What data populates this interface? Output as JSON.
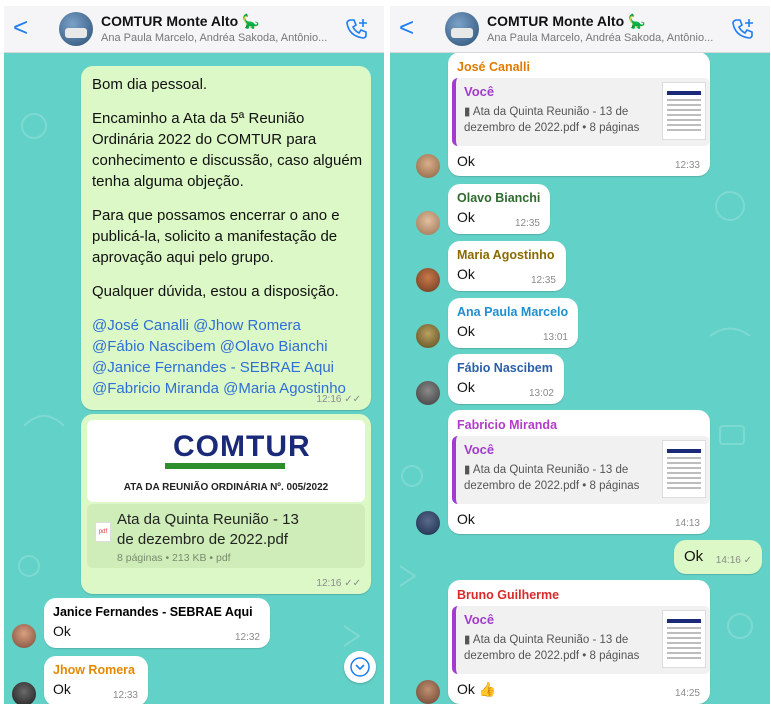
{
  "header": {
    "back_glyph": "<",
    "group_name": "COMTUR Monte Alto",
    "group_emoji": "🦕",
    "members": "Ana Paula Marcelo, Andréa Sakoda, Antônio..."
  },
  "left": {
    "announcement": {
      "p1": "Bom dia pessoal.",
      "p2": "Encaminho a Ata da 5ª Reunião Ordinária 2022 do COMTUR para conhecimento e discussão, caso alguém tenha alguma objeção.",
      "p3": "Para que possamos encerrar o ano e publicá-la, solicito a manifestação de aprovação aqui pelo grupo.",
      "p4": "Qualquer dúvida, estou a disposição.",
      "mentions": [
        "@José Canalli",
        "@Jhow Romera",
        "@Fábio Nascibem",
        "@Olavo Bianchi",
        "@Janice Fernandes - SEBRAE Aqui",
        "@Fabricio Miranda",
        "@Maria Agostinho"
      ],
      "time": "12:16",
      "ticks": "✓✓"
    },
    "document": {
      "logo_text": "COMTUR",
      "preview_heading": "ATA DA REUNIÃO ORDINÁRIA Nº. 005/2022",
      "pdf_icon_label": "pdf",
      "file_name": "Ata da Quinta Reunião - 13 de dezembro de 2022.pdf",
      "meta": "8 páginas • 213 KB • pdf",
      "time": "12:16",
      "ticks": "✓✓"
    },
    "replies": [
      {
        "sender": "Janice Fernandes - SEBRAE Aqui",
        "color": "#1e6b1e",
        "text": "Ok",
        "time": "12:32"
      },
      {
        "sender": "Jhow Romera",
        "color": "#e38a00",
        "text": "Ok",
        "time": "12:33"
      }
    ]
  },
  "right": {
    "quote": {
      "name": "Você",
      "doc_icon": "▮",
      "file": "Ata da Quinta Reunião - 13 de dezembro de 2022.pdf • 8 páginas"
    },
    "messages": [
      {
        "sender": "José Canalli",
        "color": "#e07b00",
        "text": "Ok",
        "time": "12:33"
      },
      {
        "sender": "Olavo Bianchi",
        "color": "#2e6b2e",
        "text": "Ok",
        "time": "12:35"
      },
      {
        "sender": "Maria Agostinho",
        "color": "#8a6a00",
        "text": "Ok",
        "time": "12:35"
      },
      {
        "sender": "Ana Paula Marcelo",
        "color": "#1f8fcf",
        "text": "Ok",
        "time": "13:01"
      },
      {
        "sender": "Fábio Nascibem",
        "color": "#2b5ea8",
        "text": "Ok",
        "time": "13:02"
      },
      {
        "sender": "Fabricio Miranda",
        "color": "#b23bc9",
        "text": "Ok",
        "time": "14:13"
      },
      {
        "sender": "Bruno Guilherme",
        "color": "#d82a2a",
        "text": "Ok 👍",
        "time": "14:25"
      }
    ],
    "own_reply": {
      "text": "Ok",
      "time": "14:16",
      "tick": "✓"
    }
  },
  "colors": {
    "chat_bg": "#62d1c7",
    "outgoing": "#dcf8c6",
    "incoming": "#ffffff",
    "accent": "#1c7ef2"
  }
}
